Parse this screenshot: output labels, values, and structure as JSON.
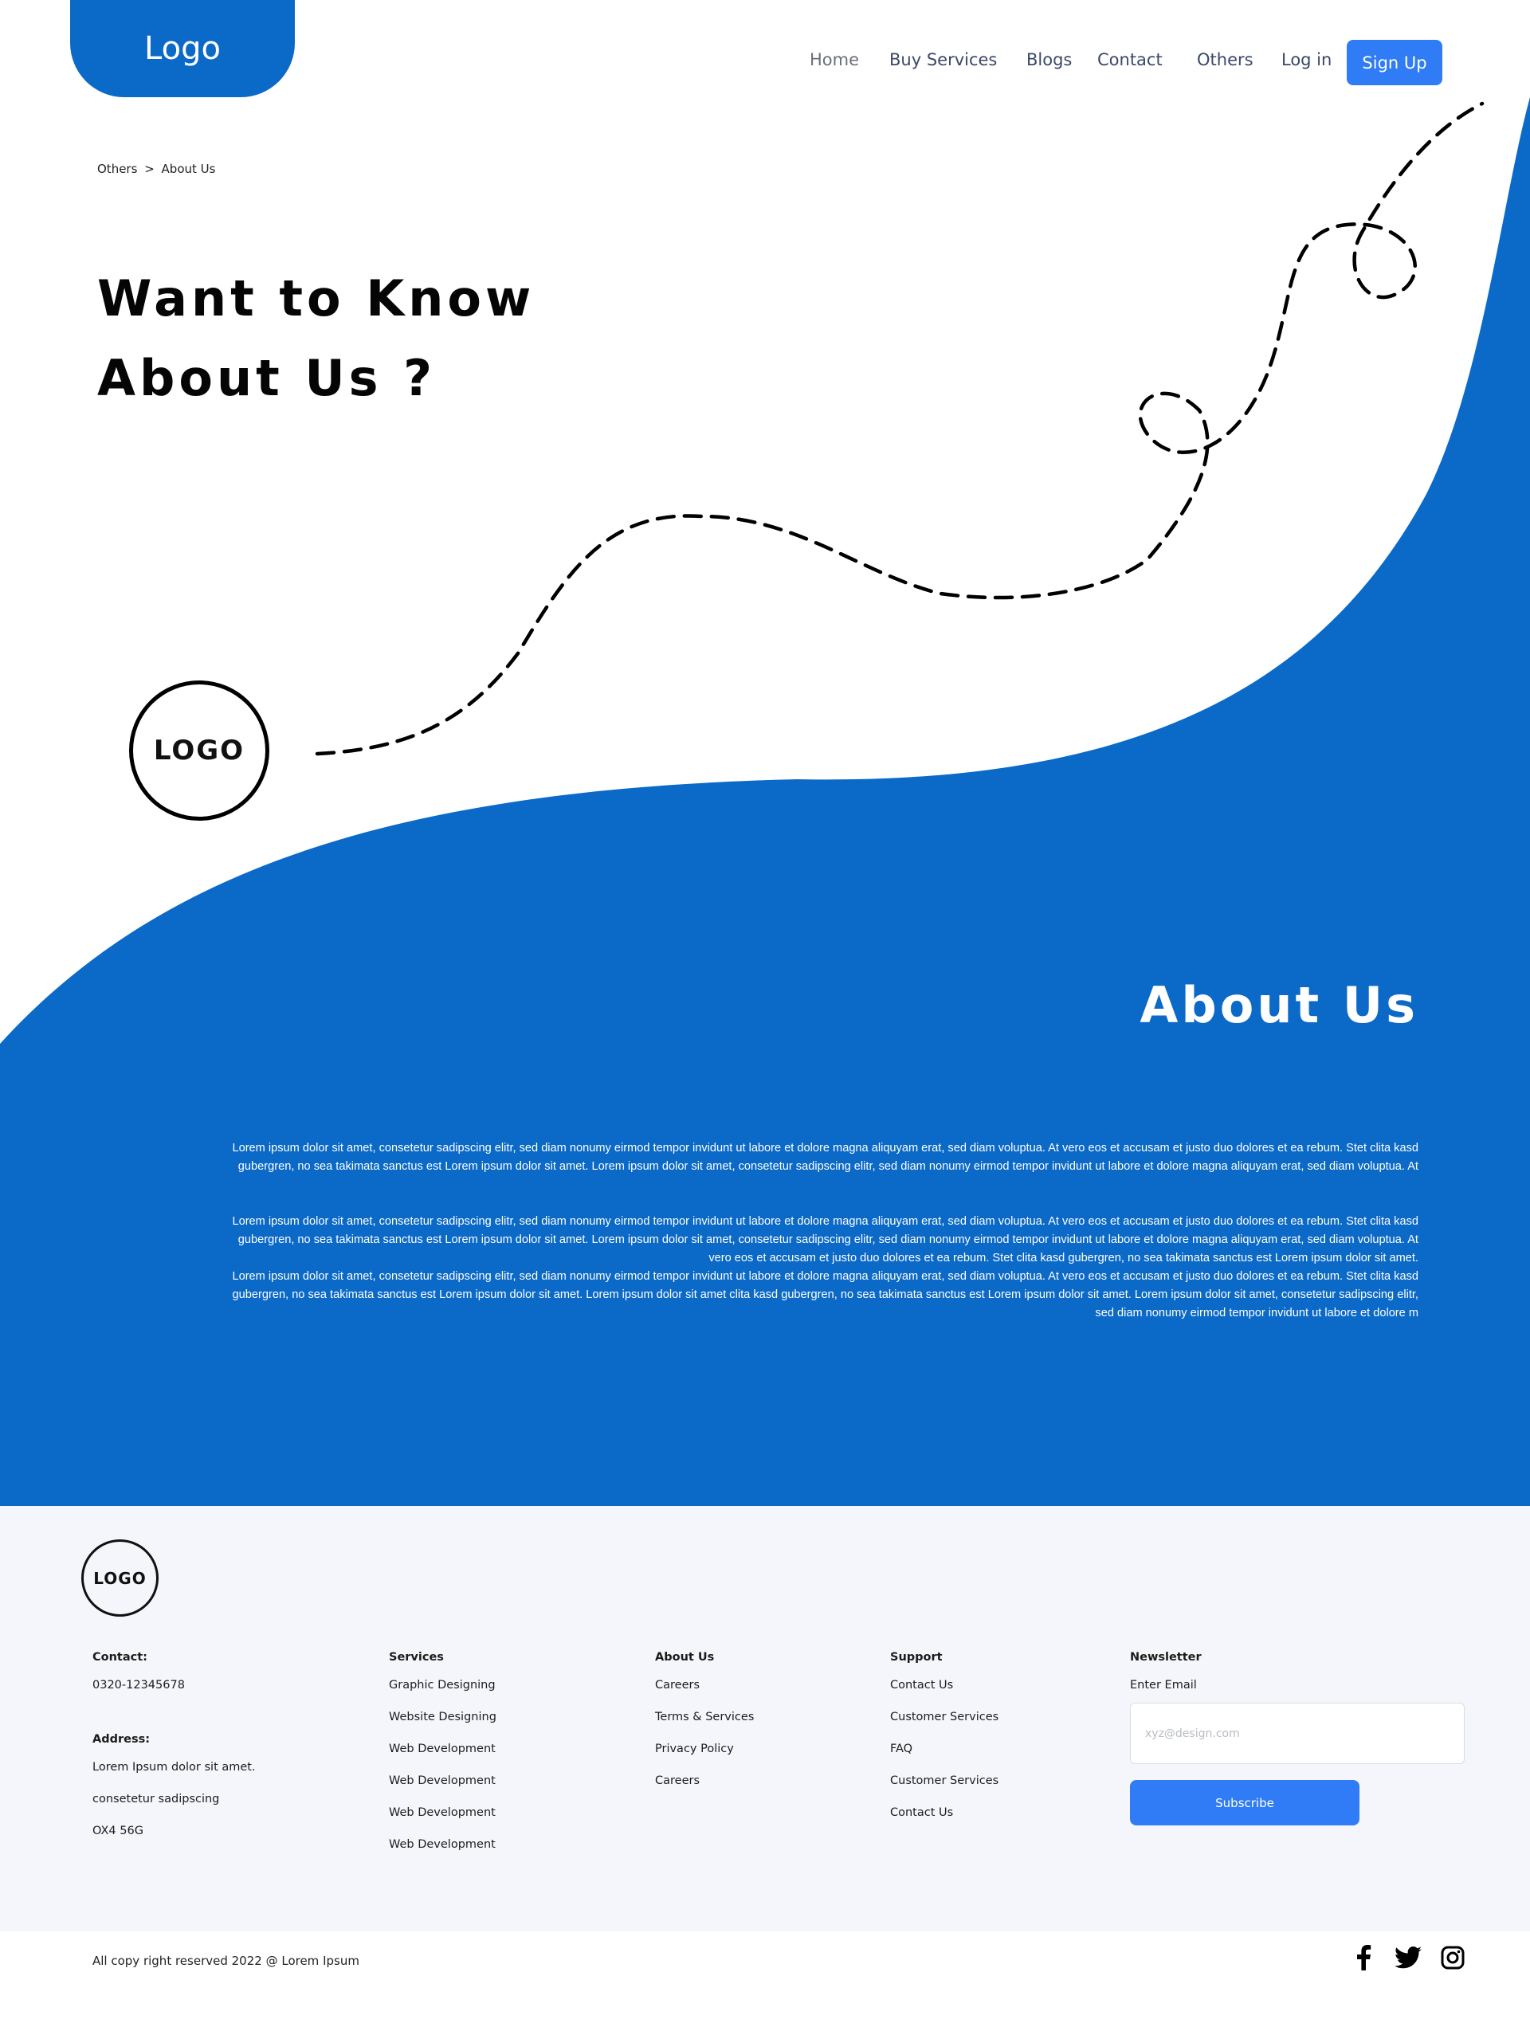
{
  "header": {
    "logo": "Logo",
    "nav": [
      "Home",
      "Buy Services",
      "Blogs",
      "Contact",
      "Others",
      "Log in"
    ],
    "signup": "Sign Up"
  },
  "breadcrumb": {
    "parent": "Others",
    "separator": ">",
    "current": "About Us"
  },
  "hero": {
    "title_line1": "Want to Know",
    "title_line2": "About Us ?",
    "logo_text": "LOGO"
  },
  "about": {
    "title": "About Us",
    "p1_line1": "Lorem ipsum dolor sit amet, consetetur sadipscing elitr, sed diam nonumy eirmod tempor invidunt ut labore et dolore magna aliquyam erat, sed diam voluptua. At vero eos et accusam et justo duo dolores et ea rebum. Stet clita kasd",
    "p1_line2": "gubergren, no sea takimata sanctus est Lorem ipsum dolor sit amet. Lorem ipsum dolor sit amet, consetetur sadipscing elitr, sed diam nonumy eirmod tempor invidunt ut labore et dolore magna aliquyam erat, sed diam voluptua. At",
    "p2_line1": "Lorem ipsum dolor sit amet, consetetur sadipscing elitr, sed diam nonumy eirmod tempor invidunt ut labore et dolore magna aliquyam erat, sed diam voluptua. At vero eos et accusam et justo duo dolores et ea rebum. Stet clita kasd",
    "p2_line2": "gubergren, no sea takimata sanctus est Lorem ipsum dolor sit amet. Lorem ipsum dolor sit amet, consetetur sadipscing elitr, sed diam nonumy eirmod tempor invidunt ut labore et dolore magna aliquyam erat, sed diam voluptua. At",
    "p2_line3": "vero eos et accusam et justo duo dolores et ea rebum. Stet clita kasd gubergren, no sea takimata sanctus est Lorem ipsum dolor sit amet.",
    "p2_line4": "Lorem ipsum dolor sit amet, consetetur sadipscing elitr, sed diam nonumy eirmod tempor invidunt ut labore et dolore magna aliquyam erat, sed diam voluptua. At vero eos et accusam et justo duo dolores et ea rebum. Stet clita kasd",
    "p2_line5": "gubergren, no sea takimata sanctus est Lorem ipsum dolor sit amet. Lorem ipsum dolor sit amet clita kasd gubergren, no sea takimata sanctus est Lorem ipsum dolor sit amet. Lorem ipsum dolor sit amet, consetetur sadipscing elitr,",
    "p2_line6": "sed diam nonumy eirmod tempor invidunt ut labore et dolore m"
  },
  "footer": {
    "logo_text": "LOGO",
    "contact": {
      "heading": "Contact:",
      "phone": "0320-12345678",
      "address_heading": "Address:",
      "address_line1": "Lorem Ipsum dolor sit amet.",
      "address_line2": "consetetur sadipscing",
      "address_line3": "OX4 56G"
    },
    "services": {
      "heading": "Services",
      "items": [
        "Graphic Designing",
        "Website Designing",
        "Web Development",
        "Web Development",
        "Web Development",
        "Web Development"
      ]
    },
    "about": {
      "heading": "About Us",
      "items": [
        "Careers",
        "Terms & Services",
        "Privacy Policy",
        "Careers"
      ]
    },
    "support": {
      "heading": "Support",
      "items": [
        "Contact Us",
        "Customer Services",
        "FAQ",
        "Customer Services",
        "Contact Us"
      ]
    },
    "newsletter": {
      "heading": "Newsletter",
      "label": "Enter Email",
      "placeholder": "xyz@design.com",
      "button": "Subscribe"
    },
    "copyright": "All copy right reserved 2022 @ Lorem Ipsum",
    "social_icons": [
      "facebook-icon",
      "twitter-icon",
      "instagram-icon"
    ]
  },
  "colors": {
    "brand_blue": "#0b69c7",
    "button_blue": "#2f7cf6",
    "footer_bg": "#f4f6fb"
  }
}
